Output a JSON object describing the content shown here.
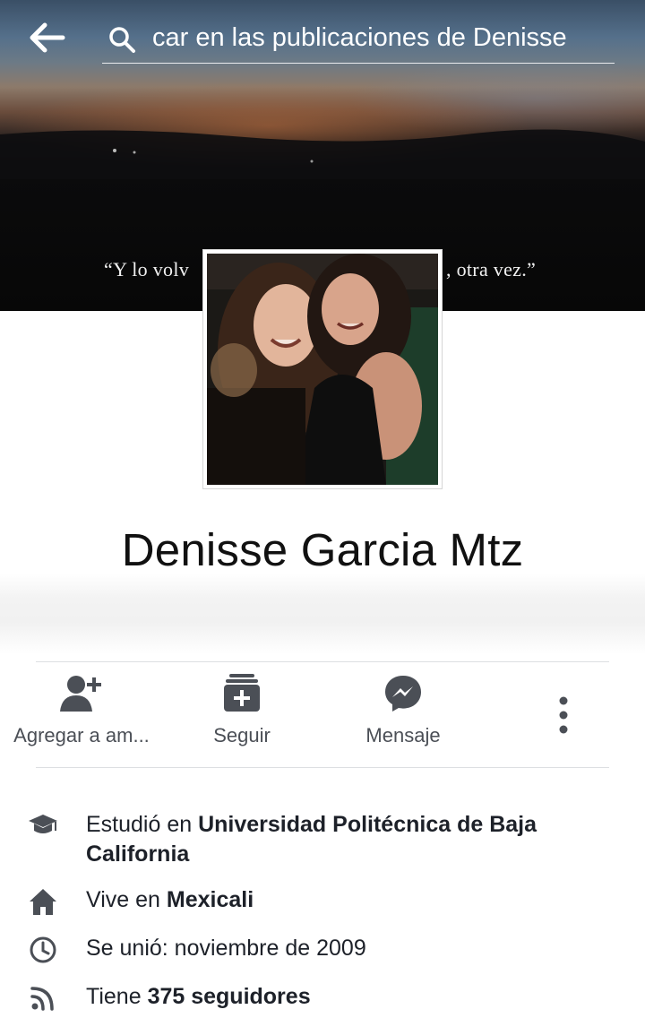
{
  "search": {
    "text": "car en las publicaciones de Denisse"
  },
  "cover": {
    "quote_left": "“Y lo volv",
    "quote_right": ", otra vez.”"
  },
  "profile": {
    "name": "Denisse Garcia Mtz"
  },
  "actions": {
    "add_friend": "Agregar a am...",
    "follow": "Seguir",
    "message": "Mensaje"
  },
  "info": {
    "studied_prefix": "Estudió en ",
    "studied_place": "Universidad Politécnica de Baja California",
    "lives_prefix": "Vive en ",
    "lives_place": "Mexicali",
    "joined": "Se unió: noviembre de 2009",
    "followers_prefix": "Tiene ",
    "followers_count": "375 seguidores"
  },
  "colors": {
    "icon_gray": "#4b4f56",
    "text_dark": "#1d2129",
    "divider": "#dddfe2"
  }
}
